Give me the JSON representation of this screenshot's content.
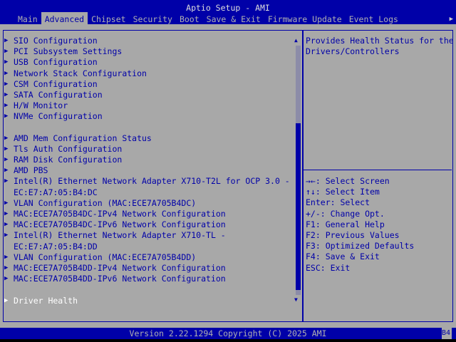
{
  "title": "Aptio Setup - AMI",
  "tabs": [
    "Main",
    "Advanced",
    "Chipset",
    "Security",
    "Boot",
    "Save & Exit",
    "Firmware Update",
    "Event Logs"
  ],
  "active_tab": 1,
  "items": [
    "SIO Configuration",
    "PCI Subsystem Settings",
    "USB Configuration",
    "Network Stack Configuration",
    "CSM Configuration",
    "SATA Configuration",
    "H/W Monitor",
    "NVMe Configuration",
    "",
    "AMD Mem Configuration Status",
    "Tls Auth Configuration",
    "RAM Disk Configuration",
    "AMD PBS",
    "Intel(R) Ethernet Network Adapter X710-T2L for OCP 3.0 -",
    "EC:E7:A7:05:B4:DC",
    "VLAN Configuration (MAC:ECE7A705B4DC)",
    "MAC:ECE7A705B4DC-IPv4 Network Configuration",
    "MAC:ECE7A705B4DC-IPv6 Network Configuration",
    "Intel(R) Ethernet Network Adapter X710-TL -",
    "EC:E7:A7:05:B4:DD",
    "VLAN Configuration (MAC:ECE7A705B4DD)",
    "MAC:ECE7A705B4DD-IPv4 Network Configuration",
    "MAC:ECE7A705B4DD-IPv6 Network Configuration",
    "",
    "Driver Health"
  ],
  "selected_item": 24,
  "help": [
    "Provides Health Status for the",
    "Drivers/Controllers"
  ],
  "keys": [
    "→←: Select Screen",
    "↑↓: Select Item",
    "Enter: Select",
    "+/-: Change Opt.",
    "F1: General Help",
    "F2: Previous Values",
    "F3: Optimized Defaults",
    "F4: Save & Exit",
    "ESC: Exit"
  ],
  "scroll": {
    "thumb_start": 0.31,
    "thumb_end": 0.98
  },
  "footer": "Version 2.22.1294 Copyright (C) 2025 AMI",
  "post_code": "B4"
}
